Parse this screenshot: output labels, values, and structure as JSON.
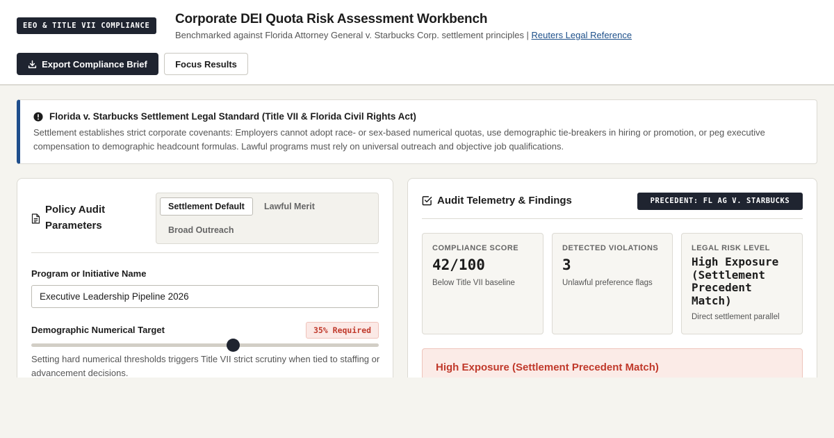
{
  "header": {
    "badge": "EEO & TITLE VII COMPLIANCE",
    "title": "Corporate DEI Quota Risk Assessment Workbench",
    "subtitle": "Benchmarked against Florida Attorney General v. Starbucks Corp. settlement principles | ",
    "reference_link": "Reuters Legal Reference",
    "export_button": "Export Compliance Brief",
    "focus_button": "Focus Results"
  },
  "alert": {
    "title": "Florida v. Starbucks Settlement Legal Standard (Title VII & Florida Civil Rights Act)",
    "body": "Settlement establishes strict corporate covenants: Employers cannot adopt race- or sex-based numerical quotas, use demographic tie-breakers in hiring or promotion, or peg executive compensation to demographic headcount formulas. Lawful programs must rely on universal outreach and objective job qualifications."
  },
  "policy": {
    "title": "Policy Audit Parameters",
    "tabs": [
      {
        "label": "Settlement Default",
        "active": true
      },
      {
        "label": "Lawful Merit",
        "active": false
      },
      {
        "label": "Broad Outreach",
        "active": false
      }
    ],
    "program_label": "Program or Initiative Name",
    "program_value": "Executive Leadership Pipeline 2026",
    "target_label": "Demographic Numerical Target",
    "target_badge": "35% Required",
    "target_slider_fraction": 0.58,
    "target_help": "Setting hard numerical thresholds triggers Title VII strict scrutiny when tied to staffing or advancement decisions."
  },
  "audit": {
    "title": "Audit Telemetry & Findings",
    "precedent_badge": "PRECEDENT: FL AG V. STARBUCKS",
    "metrics": [
      {
        "label": "COMPLIANCE SCORE",
        "value": "42/100",
        "note": "Below Title VII baseline"
      },
      {
        "label": "DETECTED VIOLATIONS",
        "value": "3",
        "note": "Unlawful preference flags"
      },
      {
        "label": "LEGAL RISK LEVEL",
        "value": "High Exposure (Settlement Precedent Match)",
        "note": "Direct settlement parallel"
      }
    ],
    "finding_title": "High Exposure (Settlement Precedent Match)"
  },
  "colors": {
    "accent_dark": "#1f2430",
    "alert_border": "#1f4e8c",
    "risk_red": "#c0392b",
    "background": "#f5f4ef"
  }
}
